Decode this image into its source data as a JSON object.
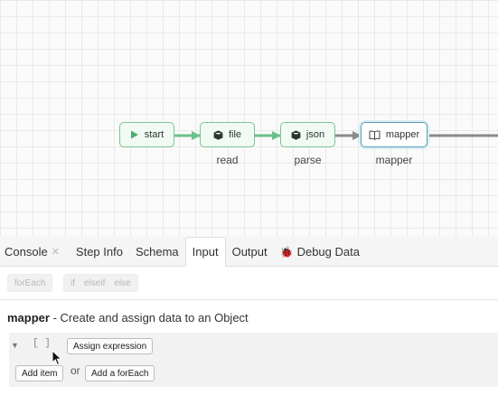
{
  "canvas": {
    "nodes": [
      {
        "id": "start",
        "text": "start",
        "label": "",
        "icon": "play-icon"
      },
      {
        "id": "file",
        "text": "file",
        "label": "read",
        "icon": "cube-icon"
      },
      {
        "id": "json",
        "text": "json",
        "label": "parse",
        "icon": "cube-icon"
      },
      {
        "id": "mapper",
        "text": "mapper",
        "label": "mapper",
        "icon": "book-icon",
        "selected": true
      }
    ],
    "colors": {
      "edge_done": "#6cc08b",
      "edge_pending": "#8a8a8a",
      "node_border": "#7cc492",
      "selected_border": "#5b9fb4"
    }
  },
  "panel": {
    "tabs": [
      {
        "label": "Console",
        "closable": true
      },
      {
        "label": "Step Info"
      },
      {
        "label": "Schema"
      },
      {
        "label": "Input",
        "active": true
      },
      {
        "label": "Output"
      },
      {
        "label": "Debug Data",
        "icon": "bug-icon"
      }
    ],
    "toolbar": {
      "foreach": "forEach",
      "if": "if",
      "elseif": "elseif",
      "else": "else"
    },
    "title": {
      "name": "mapper",
      "description": " - Create and assign data to an Object"
    },
    "editor": {
      "brackets": "[ ]",
      "assign_expression": "Assign expression",
      "add_item": "Add item",
      "or": "or",
      "add_foreach": "Add a forEach"
    }
  }
}
